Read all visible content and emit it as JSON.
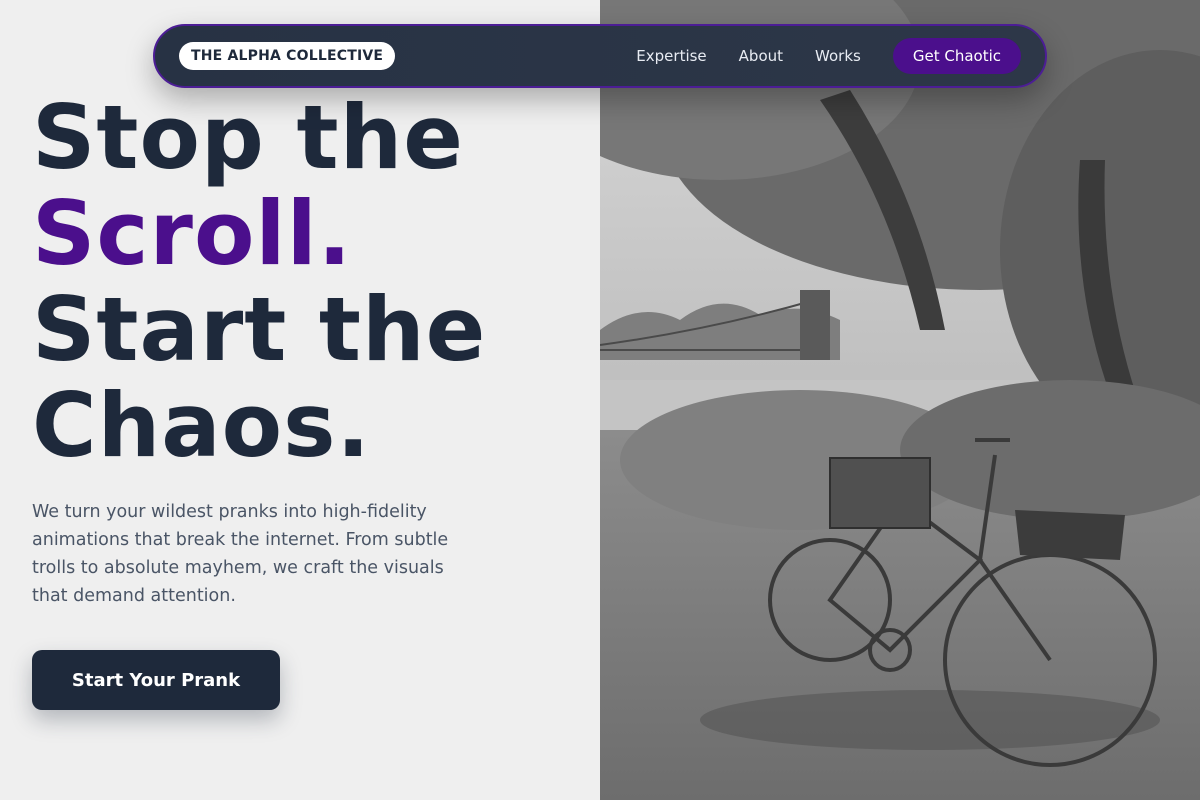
{
  "nav": {
    "brand": "THE ALPHA COLLECTIVE",
    "links": [
      {
        "label": "Expertise"
      },
      {
        "label": "About"
      },
      {
        "label": "Works"
      }
    ],
    "cta_label": "Get Chaotic"
  },
  "hero": {
    "title_line1": "Stop the",
    "title_line2": "Scroll.",
    "title_line3": "Start the",
    "title_line4": "Chaos.",
    "description": "We turn your wildest pranks into high-fidelity animations that break the internet. From subtle trolls to absolute mayhem, we craft the visuals that demand attention.",
    "cta_label": "Start Your Prank"
  },
  "colors": {
    "accent": "#4b0f8c",
    "dark": "#1e293b",
    "background": "#efefef"
  },
  "image": {
    "subject": "black-and-white photo of a bicycle with a wooden crate under trees by a river with a suspension bridge"
  }
}
